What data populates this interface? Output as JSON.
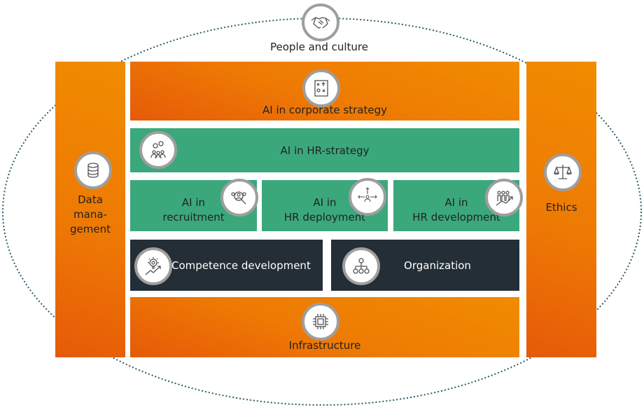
{
  "top": {
    "label": "People and culture",
    "icon": "handshake-icon"
  },
  "left_pillar": {
    "label_lines": [
      "Data",
      "mana-",
      "gement"
    ],
    "icon": "database-icon"
  },
  "right_pillar": {
    "label": "Ethics",
    "icon": "scales-icon"
  },
  "blocks": {
    "corporate_strategy": {
      "label": "AI in corporate strategy",
      "icon": "strategy-board-icon"
    },
    "hr_strategy": {
      "label": "AI in HR-strategy",
      "icon": "gears-people-icon"
    },
    "recruitment": {
      "line1": "AI in",
      "line2": "recruitment",
      "icon": "people-search-icon"
    },
    "hr_deployment": {
      "line1": "AI in",
      "line2": "HR deployment",
      "icon": "person-arrows-icon"
    },
    "hr_development": {
      "line1": "AI in",
      "line2": "HR development",
      "icon": "people-growth-icon"
    },
    "competence": {
      "label": "Competence development",
      "icon": "lightbulb-growth-icon"
    },
    "organization": {
      "label": "Organization",
      "icon": "org-chart-icon"
    },
    "infrastructure": {
      "label": "Infrastructure",
      "icon": "chip-icon"
    }
  },
  "colors": {
    "orange": "#f08a00",
    "orange_dark": "#e65a08",
    "green": "#3ba87c",
    "dark": "#232e36",
    "ellipse": "#2b5b66",
    "icon_border": "#9e9e9e"
  }
}
